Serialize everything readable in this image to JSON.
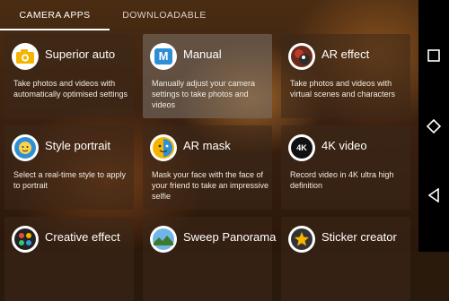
{
  "tabs": [
    {
      "label": "CAMERA APPS"
    },
    {
      "label": "DOWNLOADABLE"
    }
  ],
  "apps": [
    {
      "title": "Superior auto",
      "desc": "Take photos and videos with automatically optimised settings",
      "icon": "superior-auto-icon"
    },
    {
      "title": "Manual",
      "desc": "Manually adjust your camera settings to take photos and videos",
      "icon": "manual-m-icon"
    },
    {
      "title": "AR effect",
      "desc": "Take photos and videos with virtual scenes and characters",
      "icon": "ar-effect-icon"
    },
    {
      "title": "Style portrait",
      "desc": "Select a real-time style to apply to portrait",
      "icon": "style-portrait-icon"
    },
    {
      "title": "AR mask",
      "desc": "Mask your face with the face of your friend to take an impressive selfie",
      "icon": "ar-mask-icon"
    },
    {
      "title": "4K video",
      "desc": "Record video in 4K ultra high definition",
      "icon": "4k-video-icon",
      "badge": "4K"
    },
    {
      "title": "Creative effect",
      "desc": "",
      "icon": "creative-effect-icon"
    },
    {
      "title": "Sweep Panorama",
      "desc": "",
      "icon": "sweep-panorama-icon"
    },
    {
      "title": "Sticker creator",
      "desc": "",
      "icon": "sticker-creator-icon"
    }
  ],
  "manual_icon_letter": "M",
  "nav": [
    "recents-square-icon",
    "home-icon",
    "back-icon"
  ],
  "colors": {
    "manual_blue": "#2e8fd6",
    "accent_yellow": "#f5b400",
    "nav_bg": "#000000"
  }
}
